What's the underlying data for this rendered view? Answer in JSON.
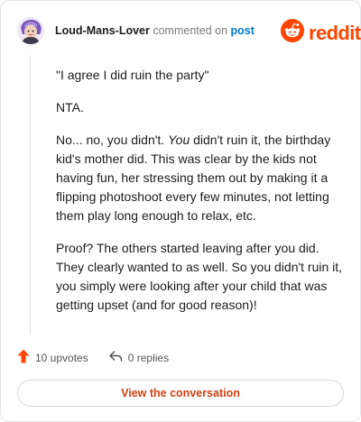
{
  "header": {
    "username": "Loud-Mans-Lover",
    "action_text": "commented on",
    "post_link": "post"
  },
  "brand": {
    "logo_icon": "reddit-snoo-icon",
    "name": "reddit",
    "color": "#ff4500"
  },
  "comment": {
    "quote": "\"I agree I did ruin the party\"",
    "verdict": "NTA.",
    "p3_before": "No... no, you didn't. ",
    "p3_emphasis": "You",
    "p3_after": " didn't ruin it, the birthday kid's mother did. This was clear by the kids not having fun, her stressing them out by making it a flipping photoshoot every few minutes, not letting them play long enough to relax, etc.",
    "p4": "Proof? The others started leaving after you did. They clearly wanted to as well. So you didn't ruin it, you simply were looking after your child that was getting upset (and for good reason)!"
  },
  "stats": {
    "upvotes_icon": "upvote-arrow-icon",
    "upvotes": "10 upvotes",
    "replies_icon": "reply-icon",
    "replies": "0 replies"
  },
  "cta": {
    "label": "View the conversation"
  }
}
